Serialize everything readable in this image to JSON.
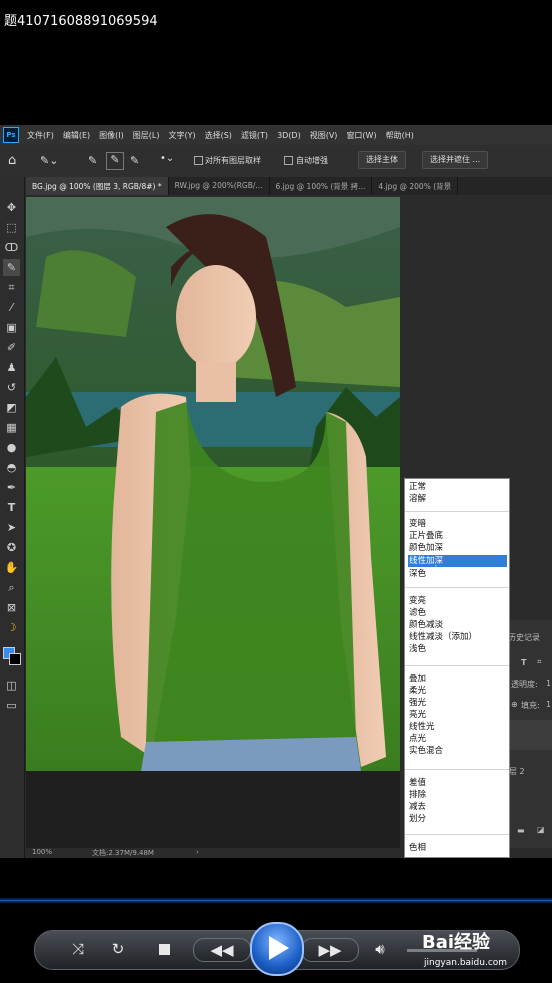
{
  "page_title": "题410716088910695​94",
  "menu": [
    "文件(F)",
    "编辑(E)",
    "图像(I)",
    "图层(L)",
    "文字(Y)",
    "选择(S)",
    "滤镜(T)",
    "3D(D)",
    "视图(V)",
    "窗口(W)",
    "帮助(H)"
  ],
  "options": {
    "sample_all_layers": "对所有图层取样",
    "auto_enhance": "自动增强",
    "select_subject": "选择主体",
    "select_and_mask": "选择并遮住 ..."
  },
  "tabs": [
    "BG.jpg @ 100% (图层 3, RGB/8#) *",
    "RW.jpg @ 200%(RGB/...",
    "6.jpg @ 100% (背景 拷...",
    "4.jpg @ 200% (背景"
  ],
  "status": {
    "zoom": "100%",
    "doc": "文档:2.37M/9.48M"
  },
  "right_panel": {
    "history": "历史记录",
    "opacity": "透明度:",
    "fill": "填充:",
    "layer": "层 2",
    "val1": "1",
    "val2": "1"
  },
  "blend_modes": {
    "group1": [
      "正常",
      "溶解"
    ],
    "group2": [
      "变暗",
      "正片叠底",
      "颜色加深",
      "线性加深",
      "深色"
    ],
    "group3": [
      "变亮",
      "滤色",
      "颜色减淡",
      "线性减淡（添加）",
      "浅色"
    ],
    "group4": [
      "叠加",
      "柔光",
      "强光",
      "亮光",
      "线性光",
      "点光",
      "实色混合"
    ],
    "group5": [
      "差值",
      "排除",
      "减去",
      "划分"
    ],
    "group6": [
      "色相"
    ],
    "selected": "线性加深"
  },
  "watermark": {
    "brand": "Bai经验",
    "url": "jingyan.baidu.com"
  },
  "colors": {
    "ps_blue": "#31a8ff",
    "selection": "#2e7fd8",
    "grass": "#3f8a22",
    "sky_mountain": "#2f5f2a"
  }
}
